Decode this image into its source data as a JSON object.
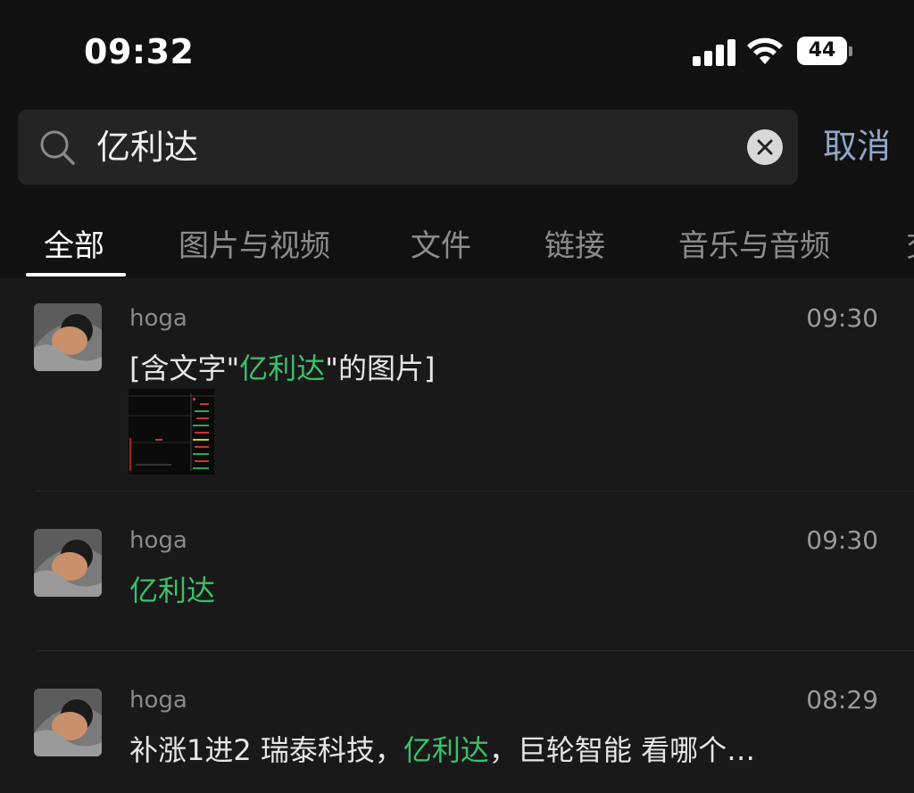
{
  "status_bar": {
    "time": "09:32",
    "battery": "44"
  },
  "search": {
    "query": "亿利达",
    "cancel_label": "取消"
  },
  "tabs": [
    {
      "label": "全部",
      "active": true
    },
    {
      "label": "图片与视频",
      "active": false
    },
    {
      "label": "文件",
      "active": false
    },
    {
      "label": "链接",
      "active": false
    },
    {
      "label": "音乐与音频",
      "active": false
    },
    {
      "label": "交",
      "active": false
    }
  ],
  "results": [
    {
      "sender": "hoga",
      "time": "09:30",
      "message_prefix": "[含文字\"",
      "message_highlight": "亿利达",
      "message_suffix": "\"的图片]",
      "has_thumbnail": true
    },
    {
      "sender": "hoga",
      "time": "09:30",
      "message_highlight": "亿利达"
    },
    {
      "sender": "hoga",
      "time": "08:29",
      "message_prefix": "补涨1进2 瑞泰科技，",
      "message_highlight": "亿利达",
      "message_suffix": "，巨轮智能 看哪个…"
    }
  ],
  "colors": {
    "highlight": "#3cc06a",
    "cancel": "#8fa7c9",
    "background": "#111111"
  }
}
